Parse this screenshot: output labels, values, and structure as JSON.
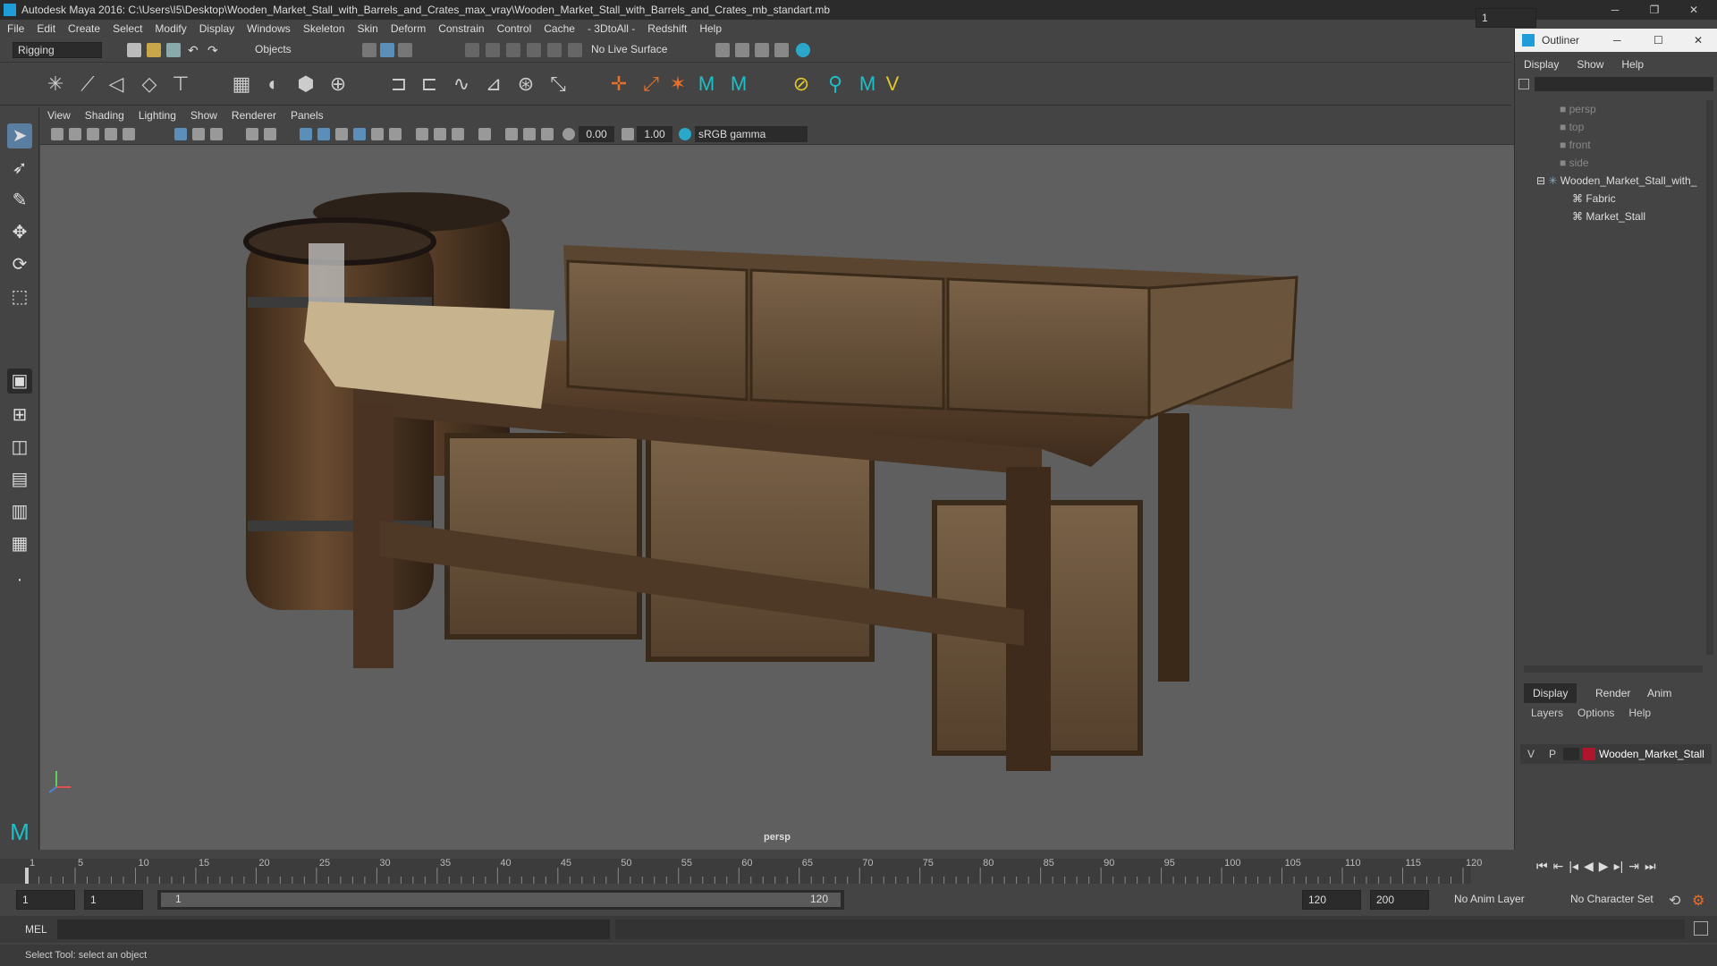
{
  "window": {
    "title": "Autodesk Maya 2016: C:\\Users\\I5\\Desktop\\Wooden_Market_Stall_with_Barrels_and_Crates_max_vray\\Wooden_Market_Stall_with_Barrels_and_Crates_mb_standart.mb"
  },
  "menubar": {
    "items": [
      "File",
      "Edit",
      "Create",
      "Select",
      "Modify",
      "Display",
      "Windows",
      "Skeleton",
      "Skin",
      "Deform",
      "Constrain",
      "Control",
      "Cache",
      "- 3DtoAll -",
      "Redshift",
      "Help"
    ]
  },
  "toolbar": {
    "mode_menu": "Rigging",
    "selection_mode": "Objects",
    "live_surface": "No Live Surface"
  },
  "viewport": {
    "menu": [
      "View",
      "Shading",
      "Lighting",
      "Show",
      "Renderer",
      "Panels"
    ],
    "exposure": "0.00",
    "gamma": "1.00",
    "color_space": "sRGB gamma",
    "camera_label": "persp"
  },
  "outliner": {
    "title": "Outliner",
    "menu": [
      "Display",
      "Show",
      "Help"
    ],
    "items": [
      {
        "label": "persp",
        "dim": true
      },
      {
        "label": "top",
        "dim": true
      },
      {
        "label": "front",
        "dim": true
      },
      {
        "label": "side",
        "dim": true
      },
      {
        "label": "Wooden_Market_Stall_with_",
        "dim": false
      },
      {
        "label": "Fabric",
        "dim": false
      },
      {
        "label": "Market_Stall",
        "dim": false
      }
    ]
  },
  "layer_editor": {
    "tabs": [
      "Display",
      "Render",
      "Anim"
    ],
    "menu": [
      "Layers",
      "Options",
      "Help"
    ],
    "layer": {
      "v": "V",
      "p": "P",
      "name": "Wooden_Market_Stall",
      "color": "#b0152e"
    }
  },
  "timeline": {
    "ticks": [
      "1",
      "5",
      "10",
      "15",
      "20",
      "25",
      "30",
      "35",
      "40",
      "45",
      "50",
      "55",
      "60",
      "65",
      "70",
      "75",
      "80",
      "85",
      "90",
      "95",
      "100",
      "105",
      "110",
      "115",
      "120"
    ],
    "current_frame": "1"
  },
  "range": {
    "start": "1",
    "playback_start": "1",
    "slider_start": "1",
    "slider_end": "120",
    "playback_end": "120",
    "end": "200",
    "anim_layer": "No Anim Layer",
    "character_set": "No Character Set"
  },
  "command_line": {
    "label": "MEL"
  },
  "help_line": {
    "text": "Select Tool: select an object"
  }
}
